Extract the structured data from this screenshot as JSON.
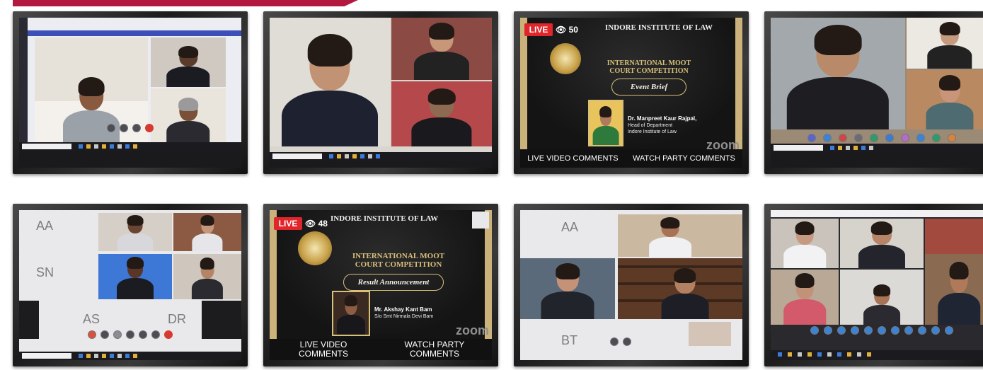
{
  "photo": {
    "subject": "collage of eight photographed computer monitors showing virtual moot court video-conference sessions",
    "accent_color": "#b3193f"
  },
  "panels": [
    {
      "id": 1
    },
    {
      "id": 2
    },
    {
      "id": 3,
      "live_label": "LIVE",
      "view_count": "50",
      "institute": "INDORE INSTITUTE OF LAW",
      "competition_line1": "INTERNATIONAL MOOT",
      "competition_line2": "COURT COMPETITION",
      "segment": "Event Brief",
      "speaker_name": "Dr. Manpreet Kaur Rajpal,",
      "speaker_role_1": "Head of Department",
      "speaker_role_2": "Indore Institute of Law",
      "watermark": "zoom",
      "left_caption": "LIVE VIDEO COMMENTS",
      "right_caption": "WATCH PARTY COMMENTS"
    },
    {
      "id": 4
    },
    {
      "id": 5,
      "initials": [
        "AA",
        "SN",
        "AS",
        "DR"
      ]
    },
    {
      "id": 6,
      "live_label": "LIVE",
      "view_count": "48",
      "institute": "INDORE INSTITUTE OF LAW",
      "competition_line1": "INTERNATIONAL MOOT",
      "competition_line2": "COURT COMPETITION",
      "segment": "Result Announcement",
      "speaker_name": "Mr. Akshay Kant Bam",
      "speaker_role_1": "S/o Smt Nirmala Devi Bam",
      "watermark": "zoom",
      "left_caption": "LIVE VIDEO COMMENTS",
      "right_caption": "WATCH PARTY COMMENTS"
    },
    {
      "id": 7,
      "initials": [
        "AA",
        "BT"
      ]
    },
    {
      "id": 8
    }
  ]
}
